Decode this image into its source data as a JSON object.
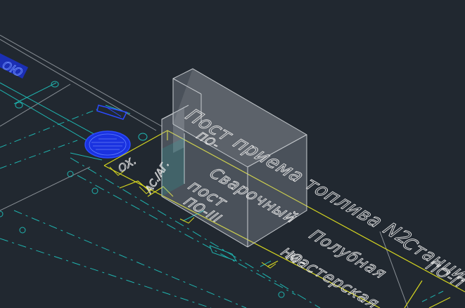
{
  "colors": {
    "background": "#212830",
    "cyan": "#1fb5b0",
    "yellow": "#d6d620",
    "blue": "#1e3cff",
    "white": "#e6e6e6",
    "gray": "#8a9096"
  },
  "labels": {
    "post_priema": "Пост приема топлива N2",
    "post_no_top": "ПО-",
    "svarochny": "Сварочный",
    "post_left": "пост",
    "no_iii": "ПО-III",
    "polubnaya": "Полубная",
    "masterskaya": "мастерская",
    "no_master": "НО-",
    "stantsiya": "Станция",
    "no_right": "ПО-П",
    "ox": "ОХ.",
    "ac_ar": "АС./АГ."
  },
  "model": {
    "icons": {
      "box": "transparent-3d-box-icon",
      "blue_ellipse": "hatched-ellipse-icon"
    }
  }
}
